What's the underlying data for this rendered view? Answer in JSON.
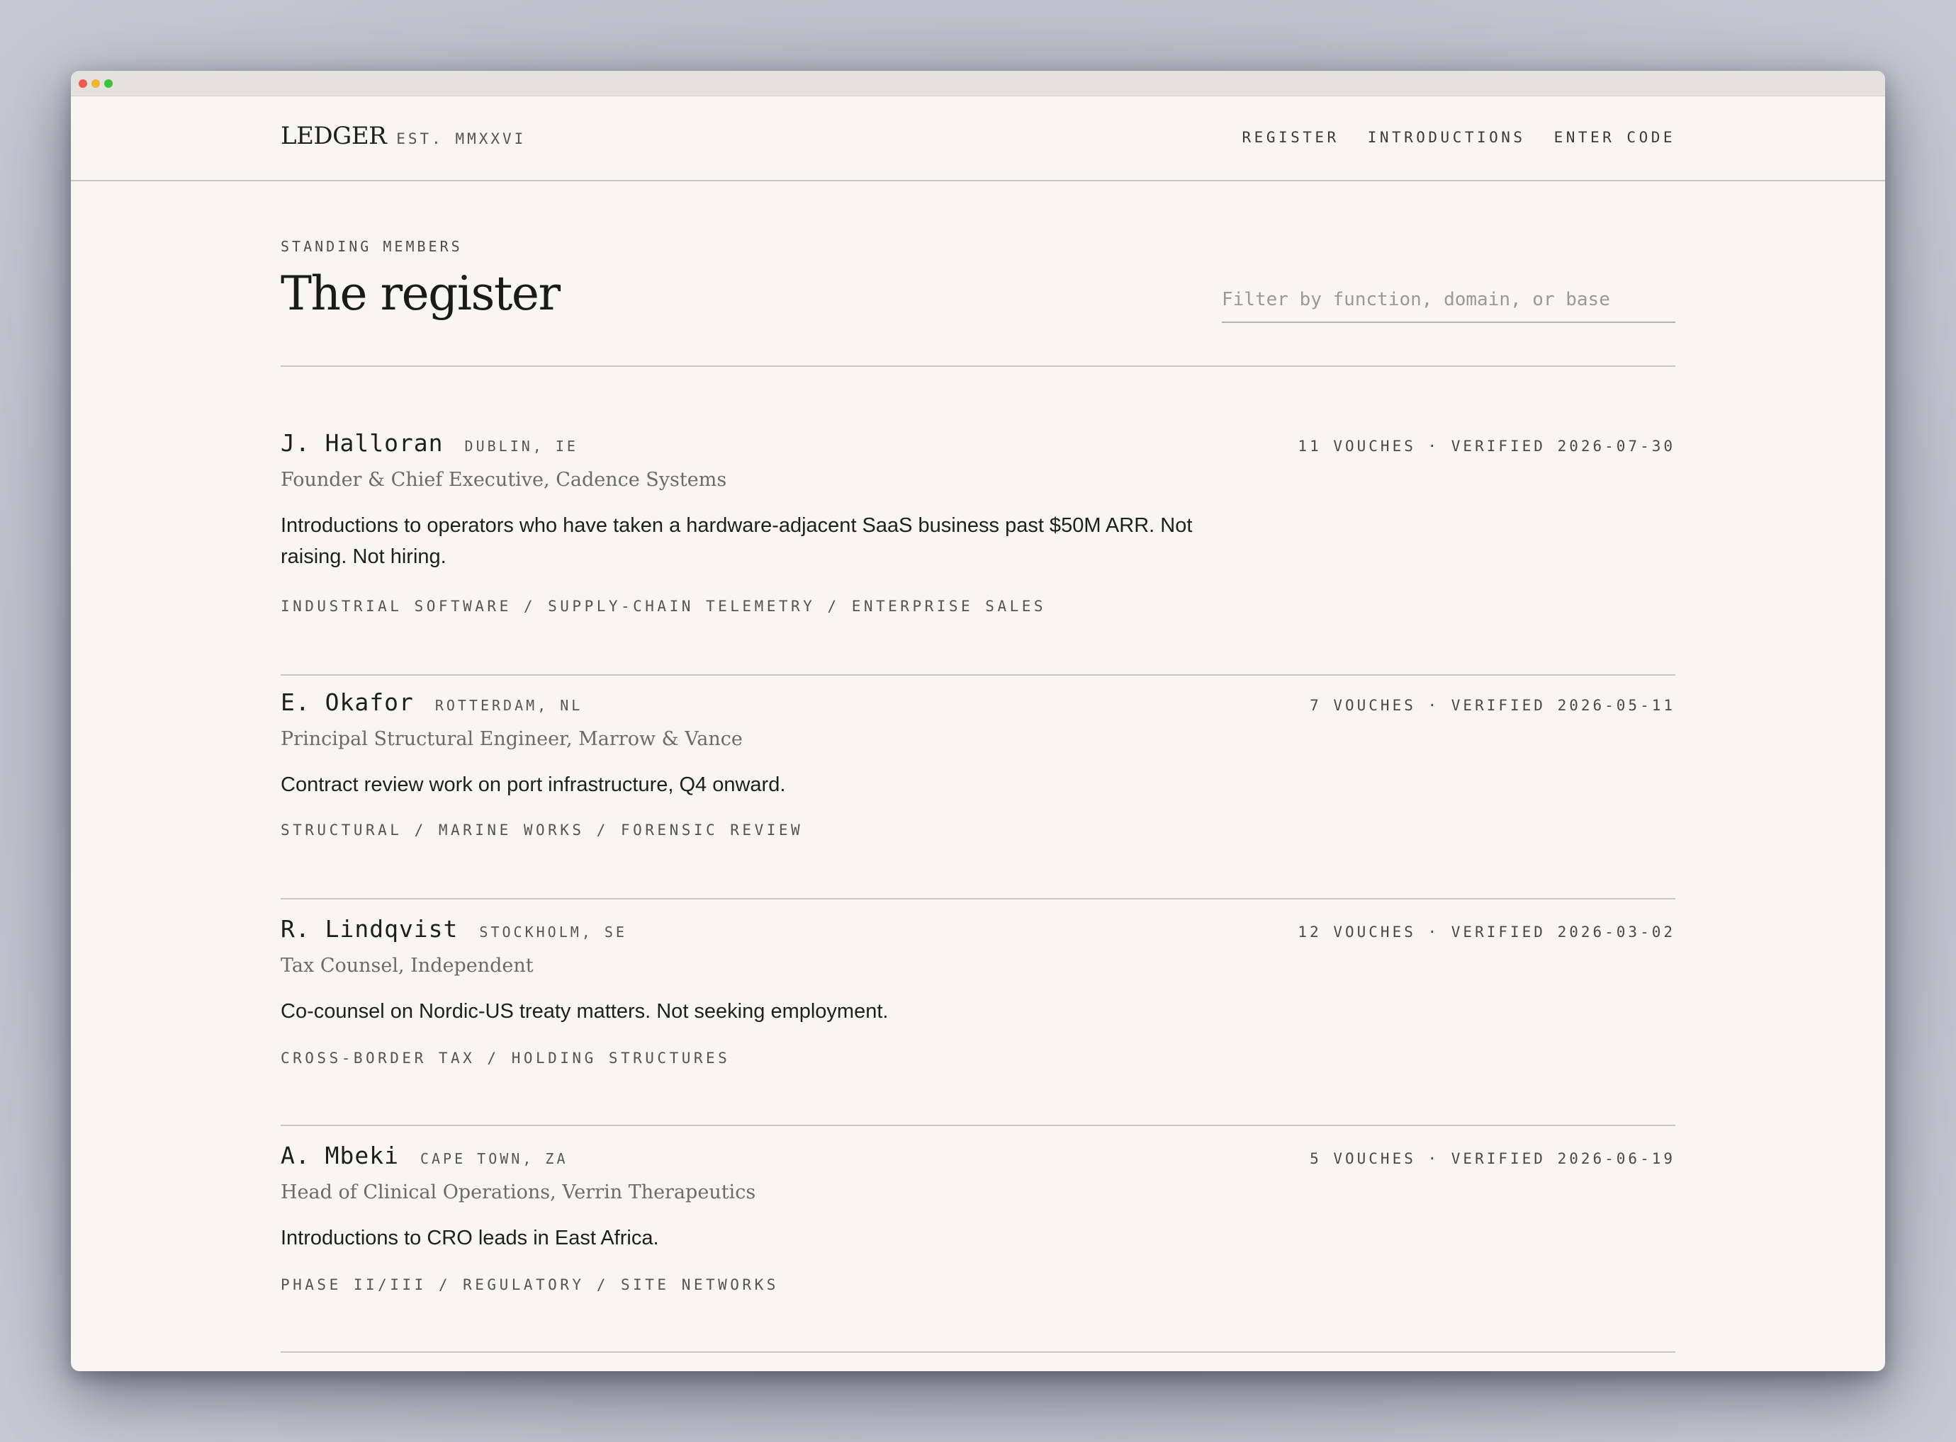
{
  "brand": {
    "name": "LEDGER",
    "est": "EST. MMXXVI"
  },
  "nav": {
    "items": [
      "REGISTER",
      "INTRODUCTIONS",
      "ENTER CODE"
    ]
  },
  "page": {
    "eyebrow": "STANDING MEMBERS",
    "title": "The register",
    "filter_placeholder": "Filter by function, domain, or base",
    "filter_value": ""
  },
  "members": [
    {
      "name": "J. Halloran",
      "city": "DUBLIN, IE",
      "meta": "11 VOUCHES · VERIFIED 2026-07-30",
      "role": "Founder & Chief Executive, Cadence Systems",
      "note": "Introductions to operators who have taken a hardware-adjacent SaaS business past $50M ARR. Not raising. Not hiring.",
      "tags": "INDUSTRIAL SOFTWARE / SUPPLY-CHAIN TELEMETRY / ENTERPRISE SALES"
    },
    {
      "name": "E. Okafor",
      "city": "ROTTERDAM, NL",
      "meta": "7 VOUCHES · VERIFIED 2026-05-11",
      "role": "Principal Structural Engineer, Marrow & Vance",
      "note": "Contract review work on port infrastructure, Q4 onward.",
      "tags": "STRUCTURAL / MARINE WORKS / FORENSIC REVIEW"
    },
    {
      "name": "R. Lindqvist",
      "city": "STOCKHOLM, SE",
      "meta": "12 VOUCHES · VERIFIED 2026-03-02",
      "role": "Tax Counsel, Independent",
      "note": "Co-counsel on Nordic-US treaty matters. Not seeking employment.",
      "tags": "CROSS-BORDER TAX / HOLDING STRUCTURES"
    },
    {
      "name": "A. Mbeki",
      "city": "CAPE TOWN, ZA",
      "meta": "5 VOUCHES · VERIFIED 2026-06-19",
      "role": "Head of Clinical Operations, Verrin Therapeutics",
      "note": "Introductions to CRO leads in East Africa.",
      "tags": "PHASE II/III / REGULATORY / SITE NETWORKS"
    }
  ]
}
